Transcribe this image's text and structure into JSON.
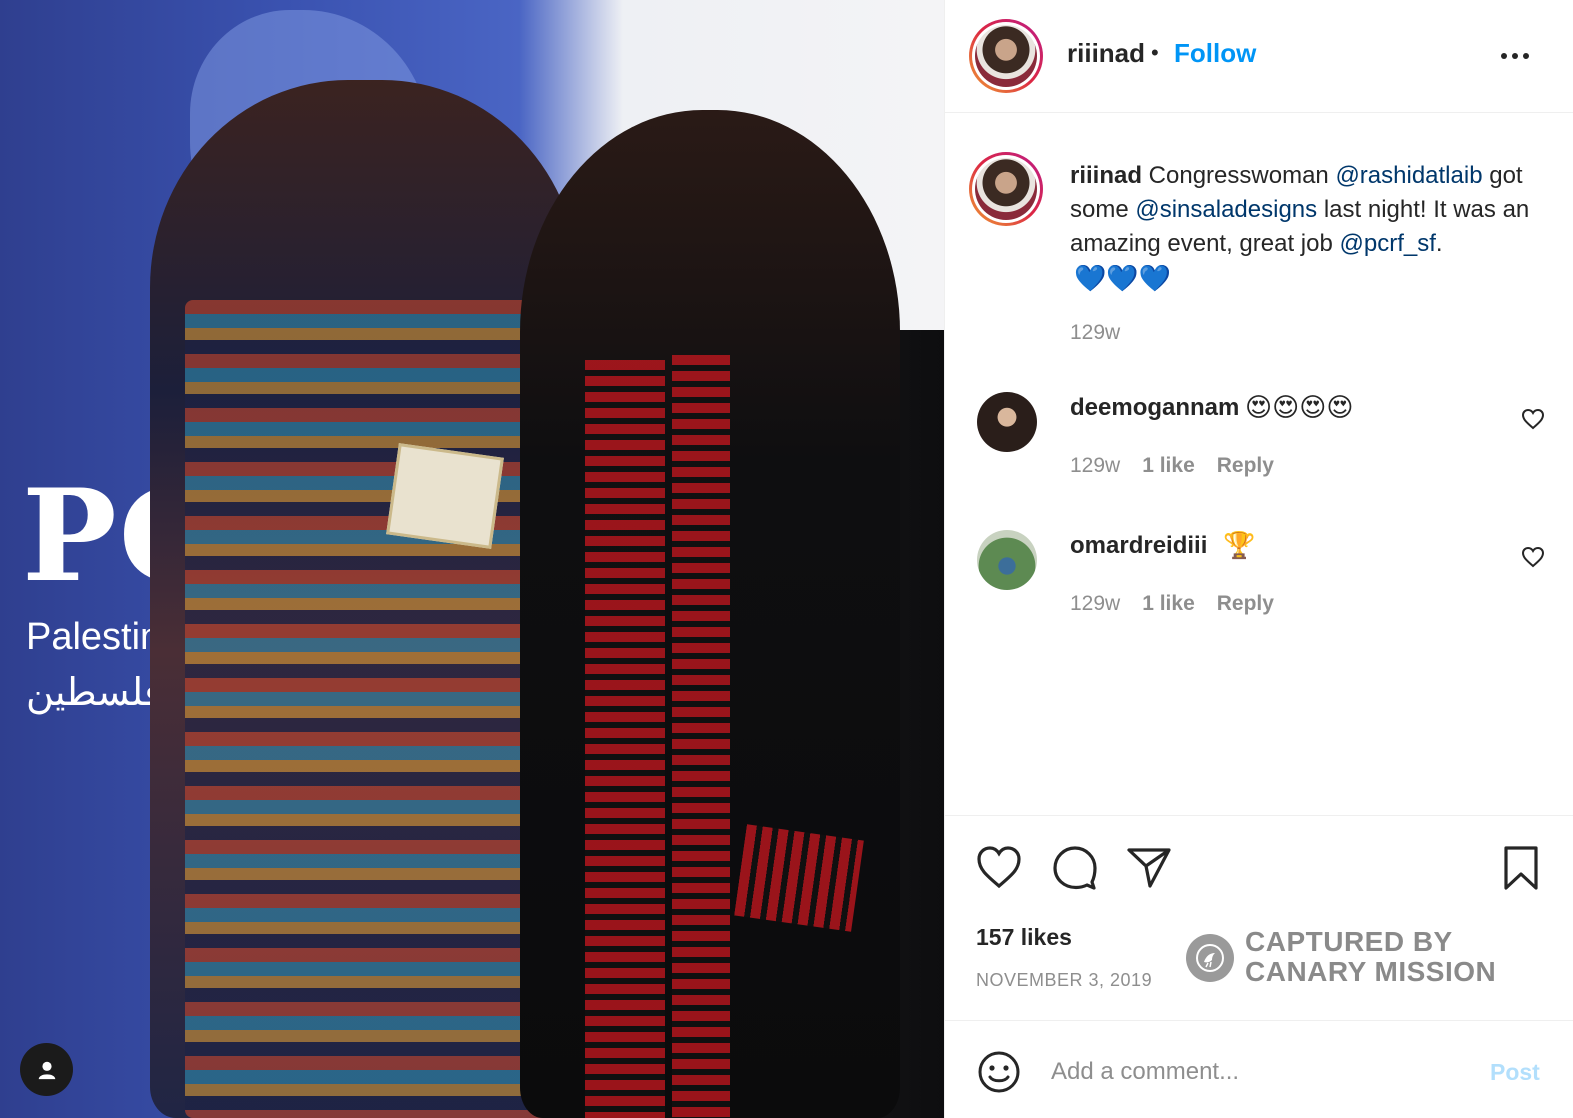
{
  "photo": {
    "banner_big": "PC",
    "banner_line": "Palestine C",
    "banner_arabic": "فلسطين"
  },
  "post": {
    "username": "riiinad",
    "separator": "•",
    "follow_label": "Follow"
  },
  "caption": {
    "username": "riiinad",
    "part1": " Congresswoman ",
    "mention1": "@rashidatlaib",
    "part2": " got some ",
    "mention2": "@sinsaladesigns",
    "part3": " last night! It was an amazing event, great job ",
    "mention3": "@pcrf_sf",
    "part4": ". ",
    "hearts": "💙💙💙",
    "time": "129w"
  },
  "comments": [
    {
      "username": "deemogannam",
      "text": "😍😍😍😍",
      "time": "129w",
      "likes": "1 like",
      "reply": "Reply"
    },
    {
      "username": "omardreidiii",
      "text": "🏆",
      "time": "129w",
      "likes": "1 like",
      "reply": "Reply"
    }
  ],
  "actions": {
    "likes": "157 likes",
    "date": "NOVEMBER 3, 2019"
  },
  "watermark": {
    "line1": "CAPTURED BY",
    "line2": "CANARY MISSION"
  },
  "add_comment": {
    "placeholder": "Add a comment...",
    "post_label": "Post"
  },
  "colors": {
    "accent": "#0095f6",
    "mention": "#00376b",
    "muted": "#8e8e8e",
    "post_disabled": "#b2dffc"
  }
}
